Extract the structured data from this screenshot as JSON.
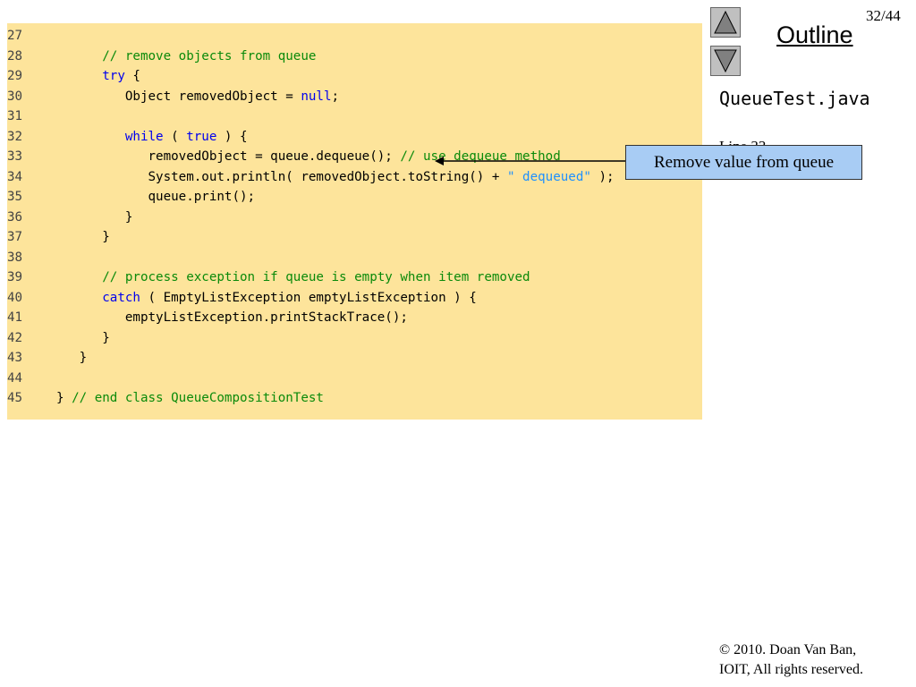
{
  "page": {
    "number": "32/44",
    "outline_label": "Outline",
    "file_name": "QueueTest.java",
    "line_ref": "Line 33",
    "callout": "Remove value from queue",
    "copyright_line1": "© 2010.  Doan Van Ban,",
    "copyright_line2": "IOIT, All rights reserved."
  },
  "nav": {
    "up_icon": "triangle-up-icon",
    "down_icon": "triangle-down-icon"
  },
  "colors": {
    "panel": "#fde49b",
    "comment": "#0a8a0a",
    "keyword": "#0000ee",
    "string": "#1e90ff",
    "callout": "#a8ccf4"
  },
  "code": {
    "lines": [
      {
        "n": "27",
        "parts": [
          {
            "t": ""
          }
        ]
      },
      {
        "n": "28",
        "parts": [
          {
            "t": "      // remove objects from queue",
            "c": "cm"
          }
        ]
      },
      {
        "n": "29",
        "parts": [
          {
            "t": "      "
          },
          {
            "t": "try",
            "c": "kw"
          },
          {
            "t": " {"
          }
        ]
      },
      {
        "n": "30",
        "parts": [
          {
            "t": "         Object removedObject = "
          },
          {
            "t": "null",
            "c": "kw"
          },
          {
            "t": ";"
          }
        ]
      },
      {
        "n": "31",
        "parts": [
          {
            "t": ""
          }
        ]
      },
      {
        "n": "32",
        "parts": [
          {
            "t": "         "
          },
          {
            "t": "while",
            "c": "kw"
          },
          {
            "t": " ( "
          },
          {
            "t": "true",
            "c": "kw"
          },
          {
            "t": " ) {"
          }
        ]
      },
      {
        "n": "33",
        "parts": [
          {
            "t": "            removedObject = queue.dequeue(); "
          },
          {
            "t": "// use dequeue method",
            "c": "cm"
          }
        ]
      },
      {
        "n": "34",
        "parts": [
          {
            "t": "            System.out.println( removedObject.toString() + "
          },
          {
            "t": "\" dequeued\"",
            "c": "str"
          },
          {
            "t": " );"
          }
        ]
      },
      {
        "n": "35",
        "parts": [
          {
            "t": "            queue.print();"
          }
        ]
      },
      {
        "n": "36",
        "parts": [
          {
            "t": "         }"
          }
        ]
      },
      {
        "n": "37",
        "parts": [
          {
            "t": "      }"
          }
        ]
      },
      {
        "n": "38",
        "parts": [
          {
            "t": ""
          }
        ]
      },
      {
        "n": "39",
        "parts": [
          {
            "t": "      // process exception if queue is empty when item removed",
            "c": "cm"
          }
        ]
      },
      {
        "n": "40",
        "parts": [
          {
            "t": "      "
          },
          {
            "t": "catch",
            "c": "kw"
          },
          {
            "t": " ( EmptyListException emptyListException ) {"
          }
        ]
      },
      {
        "n": "41",
        "parts": [
          {
            "t": "         emptyListException.printStackTrace();"
          }
        ]
      },
      {
        "n": "42",
        "parts": [
          {
            "t": "      }"
          }
        ]
      },
      {
        "n": "43",
        "parts": [
          {
            "t": "   }"
          }
        ]
      },
      {
        "n": "44",
        "parts": [
          {
            "t": ""
          }
        ]
      },
      {
        "n": "45",
        "parts": [
          {
            "t": "} "
          },
          {
            "t": "// end class QueueCompositionTest",
            "c": "cm"
          }
        ]
      }
    ]
  }
}
